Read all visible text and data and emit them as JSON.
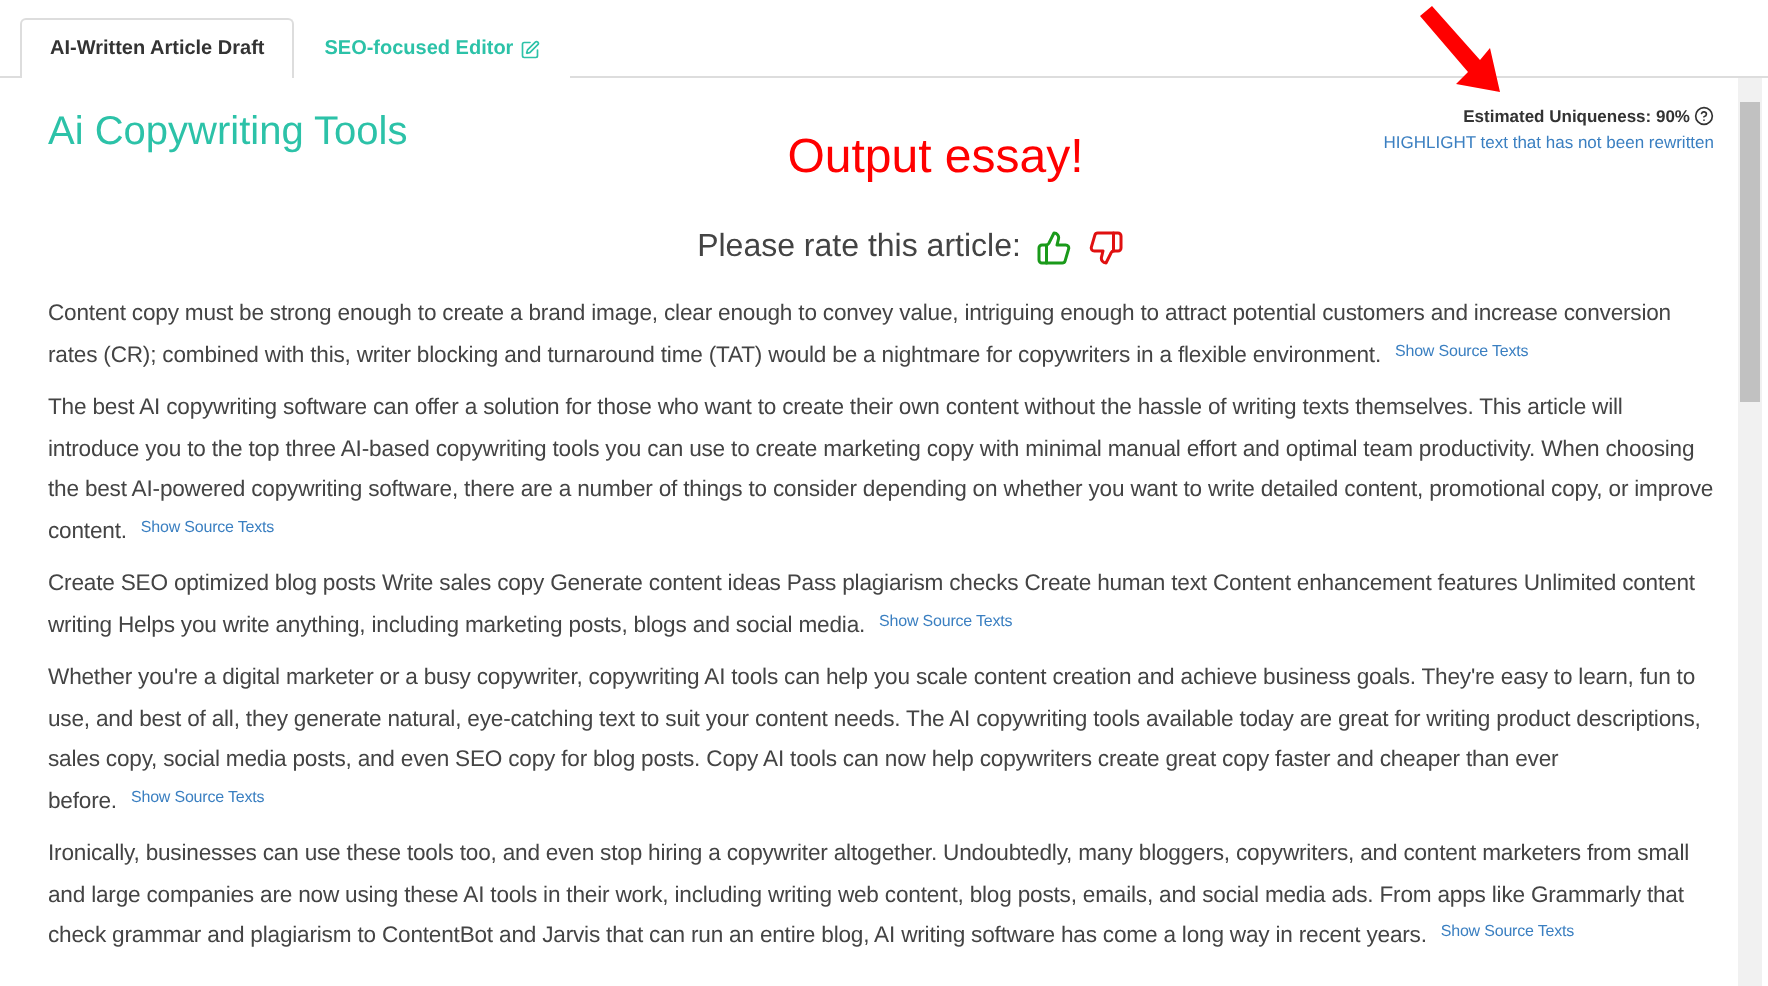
{
  "tabs": [
    {
      "label": "AI-Written Article Draft",
      "selected": true,
      "kind": "plain"
    },
    {
      "label": "SEO-focused Editor",
      "selected": false,
      "kind": "edit"
    }
  ],
  "article": {
    "title": "Ai Copywriting Tools",
    "annotation": "Output essay!",
    "uniqueness": "Estimated Uniqueness: 90%",
    "highlight_link": "HIGHLIGHT text that has not been rewritten",
    "rating_prompt": "Please rate this article:",
    "paragraphs": [
      {
        "text": "Content copy must be strong enough to create a brand image, clear enough to convey value, intriguing enough to attract potential customers and increase conversion rates (CR); combined with this, writer blocking and turnaround time (TAT) would be a nightmare for copywriters in a flexible environment.",
        "link": "Show Source Texts"
      },
      {
        "text": "The best AI copywriting software can offer a solution for those who want to create their own content without the hassle of writing texts themselves. This article will introduce you to the top three AI-based copywriting tools you can use to create marketing copy with minimal manual effort and optimal team productivity. When choosing the best AI-powered copywriting software, there are a number of things to consider depending on whether you want to write detailed content, promotional copy, or improve content.",
        "link": "Show Source Texts"
      },
      {
        "text": "Create SEO optimized blog posts Write sales copy Generate content ideas Pass plagiarism checks Create human text Content enhancement features Unlimited content writing Helps you write anything, including marketing posts, blogs and social media.",
        "link": "Show Source Texts"
      },
      {
        "text": "Whether you're a digital marketer or a busy copywriter, copywriting AI tools can help you scale content creation and achieve business goals. They're easy to learn, fun to use, and best of all, they generate natural, eye-catching text to suit your content needs. The AI copywriting tools available today are great for writing product descriptions, sales copy, social media posts, and even SEO copy for blog posts. Copy AI tools can now help copywriters create great copy faster and cheaper than ever before.",
        "link": "Show Source Texts"
      },
      {
        "text": "Ironically, businesses can use these tools too, and even stop hiring a copywriter altogether. Undoubtedly, many bloggers, copywriters, and content marketers from small and large companies are now using these AI tools in their work, including writing web content, blog posts, emails, and social media ads. From apps like Grammarly that check grammar and plagiarism to ContentBot and Jarvis that can run an entire blog, AI writing software has come a long way in recent years.",
        "link": "Show Source Texts"
      }
    ]
  }
}
